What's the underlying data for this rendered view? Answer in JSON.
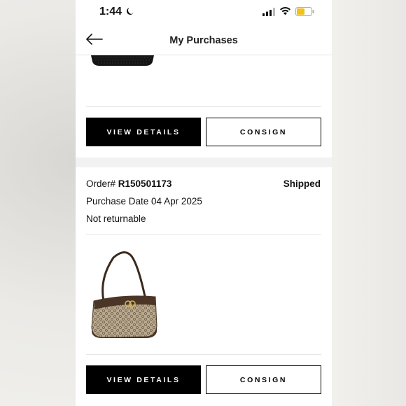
{
  "status_bar": {
    "time": "1:44",
    "icons": [
      "moon-icon",
      "cellular-signal-icon",
      "wifi-icon",
      "battery-icon"
    ],
    "battery_color": "#f2c21b"
  },
  "header": {
    "title": "My Purchases",
    "back_icon": "arrow-left-icon"
  },
  "previous_order": {
    "view_details_label": "VIEW DETAILS",
    "consign_label": "CONSIGN"
  },
  "order": {
    "order_prefix": "Order# ",
    "order_number": "R150501173",
    "status": "Shipped",
    "purchase_date": "Purchase Date 04 Apr 2025",
    "returnable": "Not returnable",
    "view_details_label": "VIEW DETAILS",
    "consign_label": "CONSIGN"
  },
  "colors": {
    "primary_button": "#000000",
    "secondary_button_border": "#000000",
    "section_gap": "#f2f2f2"
  }
}
